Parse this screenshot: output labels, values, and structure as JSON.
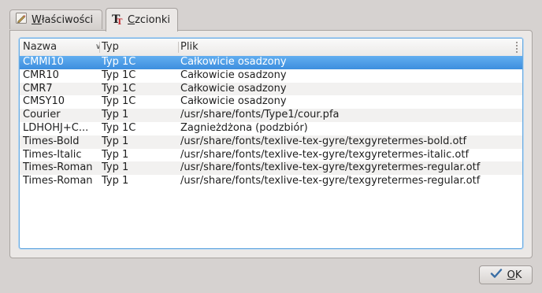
{
  "tabs": [
    {
      "label_u": "W",
      "label_rest": "łaściwości",
      "icon": "edit-icon",
      "active": false
    },
    {
      "label_u": "C",
      "label_rest": "zcionki",
      "icon": "font-icon",
      "active": true
    }
  ],
  "table": {
    "columns": [
      "Nazwa",
      "Typ",
      "Plik"
    ],
    "rows": [
      {
        "name": "CMMI10",
        "type": "Typ 1C",
        "file": "Całkowicie osadzony",
        "selected": true
      },
      {
        "name": "CMR10",
        "type": "Typ 1C",
        "file": "Całkowicie osadzony"
      },
      {
        "name": "CMR7",
        "type": "Typ 1C",
        "file": "Całkowicie osadzony"
      },
      {
        "name": "CMSY10",
        "type": "Typ 1C",
        "file": "Całkowicie osadzony"
      },
      {
        "name": "Courier",
        "type": "Typ 1",
        "file": "/usr/share/fonts/Type1/cour.pfa"
      },
      {
        "name": "LDHOHJ+C...",
        "type": "Typ 1C",
        "file": "Zagnieżdżona (podzbiór)"
      },
      {
        "name": "Times-Bold",
        "type": "Typ 1",
        "file": "/usr/share/fonts/texlive-tex-gyre/texgyretermes-bold.otf"
      },
      {
        "name": "Times-Italic",
        "type": "Typ 1",
        "file": "/usr/share/fonts/texlive-tex-gyre/texgyretermes-italic.otf"
      },
      {
        "name": "Times-Roman",
        "type": "Typ 1",
        "file": "/usr/share/fonts/texlive-tex-gyre/texgyretermes-regular.otf"
      },
      {
        "name": "Times-Roman",
        "type": "Typ 1",
        "file": "/usr/share/fonts/texlive-tex-gyre/texgyretermes-regular.otf"
      }
    ]
  },
  "ok_button": {
    "label_u": "O",
    "label_rest": "K",
    "icon": "check-icon"
  },
  "colors": {
    "selection": "#4a9be6",
    "focus_border": "#6aaae0"
  }
}
